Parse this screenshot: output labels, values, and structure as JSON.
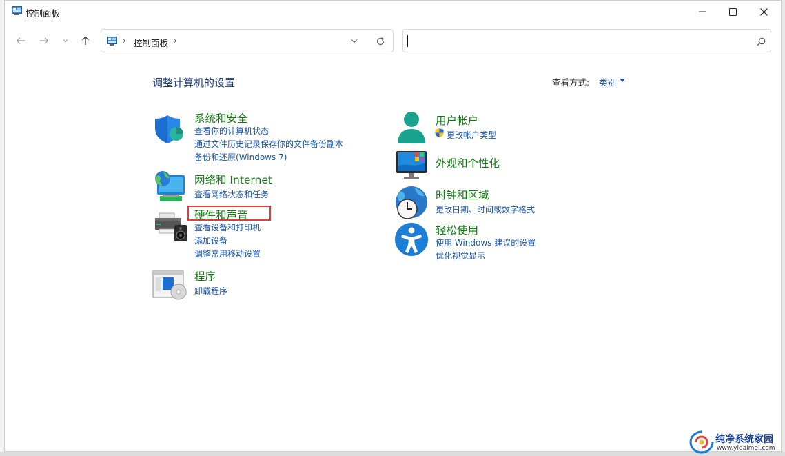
{
  "window": {
    "title": "控制面板",
    "controls": {
      "minimize": "minimize-icon",
      "maximize": "maximize-icon",
      "close": "close-icon"
    }
  },
  "toolbar": {
    "back": "back-arrow-icon",
    "forward": "forward-arrow-icon",
    "recent": "chevron-down-icon",
    "up": "up-arrow-icon"
  },
  "address": {
    "crumb": "控制面板",
    "separator": "›"
  },
  "search": {
    "value": "",
    "placeholder": ""
  },
  "main": {
    "heading": "调整计算机的设置",
    "view_by_label": "查看方式:",
    "view_by_value": "类别"
  },
  "categories": [
    {
      "title": "系统和安全",
      "links": [
        "查看你的计算机状态",
        "通过文件历史记录保存你的文件备份副本",
        "备份和还原(Windows 7)"
      ],
      "icon": "shield-icon"
    },
    {
      "title": "网络和 Internet",
      "links": [
        "查看网络状态和任务"
      ],
      "icon": "network-globe-icon"
    },
    {
      "title": "硬件和声音",
      "links": [
        "查看设备和打印机",
        "添加设备",
        "调整常用移动设置"
      ],
      "icon": "printer-speaker-icon"
    },
    {
      "title": "程序",
      "links": [
        "卸载程序"
      ],
      "icon": "programs-disc-icon"
    },
    {
      "title": "用户帐户",
      "links": [
        "更改帐户类型"
      ],
      "icon": "user-icon"
    },
    {
      "title": "外观和个性化",
      "links": [],
      "icon": "monitor-palette-icon"
    },
    {
      "title": "时钟和区域",
      "links": [
        "更改日期、时间或数字格式"
      ],
      "icon": "clock-globe-icon"
    },
    {
      "title": "轻松使用",
      "links": [
        "使用 Windows 建议的设置",
        "优化视觉显示"
      ],
      "icon": "accessibility-icon"
    }
  ],
  "watermark": {
    "title": "纯净系统家园",
    "url": "www.yidaimei.com"
  },
  "colors": {
    "category_title": "#107c10",
    "link": "#1a55a8",
    "heading": "#1e3a78",
    "highlight_border": "#e03c3c"
  }
}
